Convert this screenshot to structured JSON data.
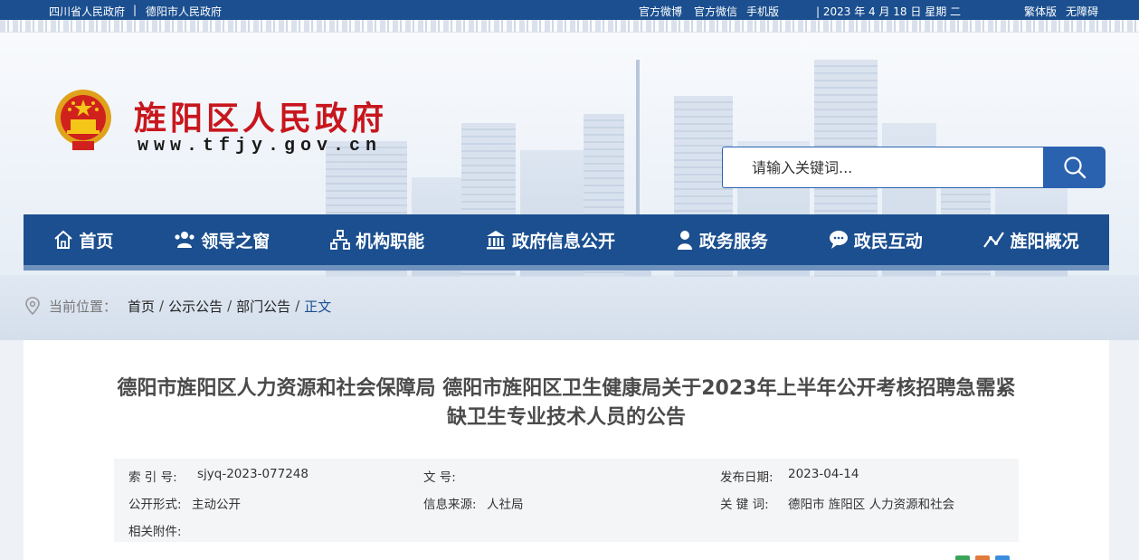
{
  "topbar": {
    "link_sichuan": "四川省人民政府",
    "divider": "|",
    "link_deyang": "德阳市人民政府",
    "weibo": "官方微博",
    "wechat": "官方微信",
    "mobile": "手机版",
    "date": "| 2023 年 4 月 18 日 星期 二",
    "traditional": "繁体版",
    "accessible": "无障碍"
  },
  "header": {
    "site_title": "旌阳区人民政府",
    "site_url": "www.tfjy.gov.cn",
    "search_placeholder": "请输入关键词..."
  },
  "nav": {
    "items": [
      {
        "label": "首页",
        "icon": "home-icon"
      },
      {
        "label": "领导之窗",
        "icon": "people-icon"
      },
      {
        "label": "机构职能",
        "icon": "org-chart-icon"
      },
      {
        "label": "政府信息公开",
        "icon": "building-icon"
      },
      {
        "label": "政务服务",
        "icon": "user-service-icon"
      },
      {
        "label": "政民互动",
        "icon": "chat-icon"
      },
      {
        "label": "旌阳概况",
        "icon": "chart-line-icon"
      }
    ]
  },
  "breadcrumb": {
    "prefix": "当前位置：",
    "items": [
      "首页",
      "公示公告",
      "部门公告",
      "正文"
    ],
    "sep": "/"
  },
  "article": {
    "title": "德阳市旌阳区人力资源和社会保障局 德阳市旌阳区卫生健康局关于2023年上半年公开考核招聘急需紧缺卫生专业技术人员的公告",
    "meta": {
      "index_label": "索  引  号:",
      "index_value": "sjyq-2023-077248",
      "doc_no_label": "文   号:",
      "doc_no_value": "",
      "publish_label": "发布日期:",
      "publish_value": "2023-04-14",
      "form_label": "公开形式:",
      "form_value": "主动公开",
      "source_label": "信息来源:",
      "source_value": "人社局",
      "keywords_label": "关  键  词:",
      "keywords_value": "德阳市 旌阳区 人力资源和社会",
      "attach_label": "相关附件:"
    }
  },
  "colors": {
    "primary": "#1b4f8f",
    "title_red": "#c8161d",
    "search_blue": "#2a62b0"
  }
}
